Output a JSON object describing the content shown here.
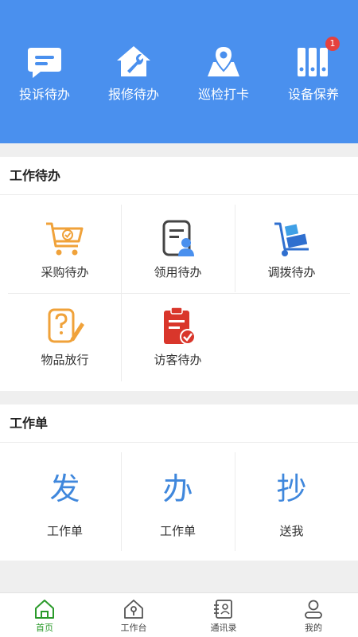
{
  "header": {
    "bg_color": "#4a90ee",
    "quick_actions": [
      {
        "label": "投诉待办",
        "icon": "chat-icon"
      },
      {
        "label": "报修待办",
        "icon": "repair-house-icon"
      },
      {
        "label": "巡检打卡",
        "icon": "map-pin-icon"
      },
      {
        "label": "设备保养",
        "icon": "binders-icon",
        "badge": "1"
      }
    ]
  },
  "todo_section": {
    "title": "工作待办",
    "items": [
      {
        "label": "采购待办",
        "icon": "shopping-cart-icon"
      },
      {
        "label": "领用待办",
        "icon": "document-user-icon"
      },
      {
        "label": "调拨待办",
        "icon": "hand-truck-icon"
      },
      {
        "label": "物品放行",
        "icon": "question-edit-icon"
      },
      {
        "label": "访客待办",
        "icon": "clipboard-check-icon"
      }
    ]
  },
  "worksheet_section": {
    "title": "工作单",
    "items": [
      {
        "char": "发",
        "label": "工作单"
      },
      {
        "char": "办",
        "label": "工作单"
      },
      {
        "char": "抄",
        "label": "送我"
      }
    ]
  },
  "tabbar": {
    "active_color": "#2a9a2a",
    "tabs": [
      {
        "label": "首页",
        "icon": "home-icon",
        "active": true
      },
      {
        "label": "工作台",
        "icon": "workbench-icon",
        "active": false
      },
      {
        "label": "通讯录",
        "icon": "contacts-icon",
        "active": false
      },
      {
        "label": "我的",
        "icon": "profile-icon",
        "active": false
      }
    ]
  }
}
